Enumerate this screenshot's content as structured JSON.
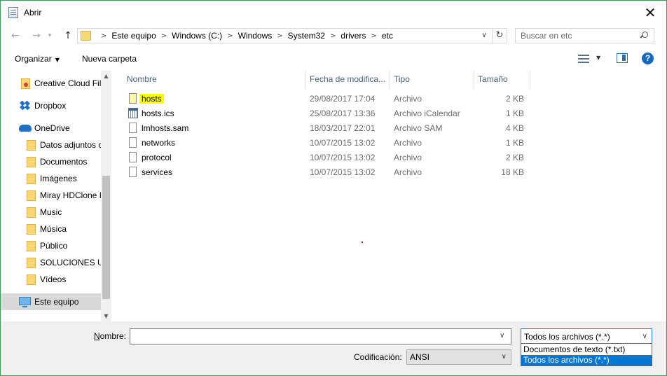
{
  "window": {
    "title": "Abrir"
  },
  "nav": {
    "crumbs": [
      "Este equipo",
      "Windows (C:)",
      "Windows",
      "System32",
      "drivers",
      "etc"
    ],
    "search_placeholder": "Buscar en etc"
  },
  "toolbar": {
    "organize_label": "Organizar",
    "new_folder_label": "Nueva carpeta"
  },
  "sidebar": {
    "items": [
      {
        "label": "Creative Cloud Fil",
        "icon": "creative-cloud-folder-icon"
      },
      {
        "label": "Dropbox",
        "icon": "dropbox-icon"
      },
      {
        "label": "OneDrive",
        "icon": "onedrive-cloud-icon"
      },
      {
        "label": "Datos adjuntos c",
        "icon": "folder-icon"
      },
      {
        "label": "Documentos",
        "icon": "folder-icon"
      },
      {
        "label": "Imágenes",
        "icon": "folder-icon"
      },
      {
        "label": "Miray HDClone I",
        "icon": "folder-icon"
      },
      {
        "label": "Music",
        "icon": "folder-icon"
      },
      {
        "label": "Música",
        "icon": "folder-icon"
      },
      {
        "label": "Público",
        "icon": "folder-icon"
      },
      {
        "label": "SOLUCIONES UN",
        "icon": "folder-icon"
      },
      {
        "label": "Vídeos",
        "icon": "folder-icon"
      },
      {
        "label": "Este equipo",
        "icon": "computer-icon"
      }
    ]
  },
  "columns": {
    "name": "Nombre",
    "date": "Fecha de modifica...",
    "type": "Tipo",
    "size": "Tamaño"
  },
  "files": [
    {
      "name": "hosts",
      "date": "29/08/2017 17:04",
      "type": "Archivo",
      "size": "2 KB",
      "icon": "file-icon"
    },
    {
      "name": "hosts.ics",
      "date": "25/08/2017 13:36",
      "type": "Archivo iCalendar",
      "size": "1 KB",
      "icon": "calendar-file-icon"
    },
    {
      "name": "lmhosts.sam",
      "date": "18/03/2017 22:01",
      "type": "Archivo SAM",
      "size": "4 KB",
      "icon": "file-icon"
    },
    {
      "name": "networks",
      "date": "10/07/2015 13:02",
      "type": "Archivo",
      "size": "1 KB",
      "icon": "file-icon"
    },
    {
      "name": "protocol",
      "date": "10/07/2015 13:02",
      "type": "Archivo",
      "size": "2 KB",
      "icon": "file-icon"
    },
    {
      "name": "services",
      "date": "10/07/2015 13:02",
      "type": "Archivo",
      "size": "18 KB",
      "icon": "file-icon"
    }
  ],
  "bottom": {
    "name_label_underlined": "N",
    "name_label_rest": "ombre:",
    "name_value": "",
    "filter_selected": "Todos los archivos  (*.*)",
    "filter_options": [
      "Documentos de texto (*.txt)",
      "Todos los archivos  (*.*)"
    ],
    "encoding_label": "Codificación:",
    "encoding_value": "ANSI"
  },
  "colors": {
    "highlight": "#ffff00",
    "accent": "#0078d7",
    "window_border": "#3c9d5a"
  }
}
